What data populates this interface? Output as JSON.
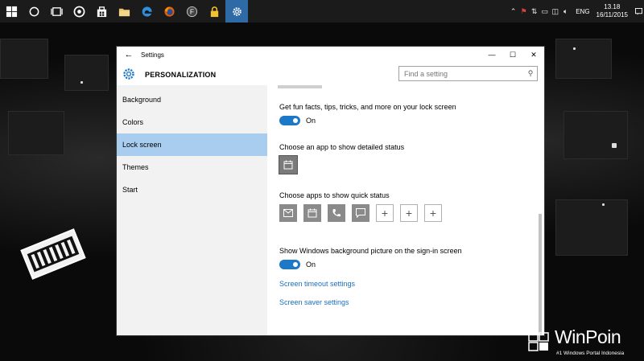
{
  "taskbar": {
    "icons": [
      "start-icon",
      "search-icon",
      "task-view-icon",
      "groove-icon",
      "store-icon",
      "file-explorer-icon",
      "edge-icon",
      "firefox-icon",
      "app-f-icon",
      "lock-icon",
      "settings-icon"
    ],
    "active_color": "#2d6aa6",
    "tray": {
      "language": "ENG",
      "time": "13.18",
      "date": "16/11/2015"
    }
  },
  "window": {
    "title": "Settings",
    "page_title": "PERSONALIZATION",
    "search": {
      "placeholder": "Find a setting"
    },
    "sidebar": {
      "items": [
        {
          "label": "Background",
          "selected": false
        },
        {
          "label": "Colors",
          "selected": false
        },
        {
          "label": "Lock screen",
          "selected": true
        },
        {
          "label": "Themes",
          "selected": false
        },
        {
          "label": "Start",
          "selected": false
        }
      ]
    },
    "content": {
      "fun_facts_label": "Get fun facts, tips, tricks, and more on your lock screen",
      "fun_facts_state": "On",
      "detailed_status_label": "Choose an app to show detailed status",
      "quick_status_label": "Choose apps to show quick status",
      "quick_status_apps": [
        "mail-icon",
        "calendar-icon",
        "phone-icon",
        "message-icon",
        "plus-icon",
        "plus-icon",
        "plus-icon"
      ],
      "signin_bg_label": "Show Windows background picture on the sign-in screen",
      "signin_bg_state": "On",
      "screen_timeout_link": "Screen timeout settings",
      "screen_saver_link": "Screen saver settings"
    },
    "accent_color": "#1e78c8",
    "selection_color": "#a9cdef"
  },
  "watermark": {
    "brand": "WinPoin",
    "tagline": "#1 Windows Portal Indonesia"
  }
}
